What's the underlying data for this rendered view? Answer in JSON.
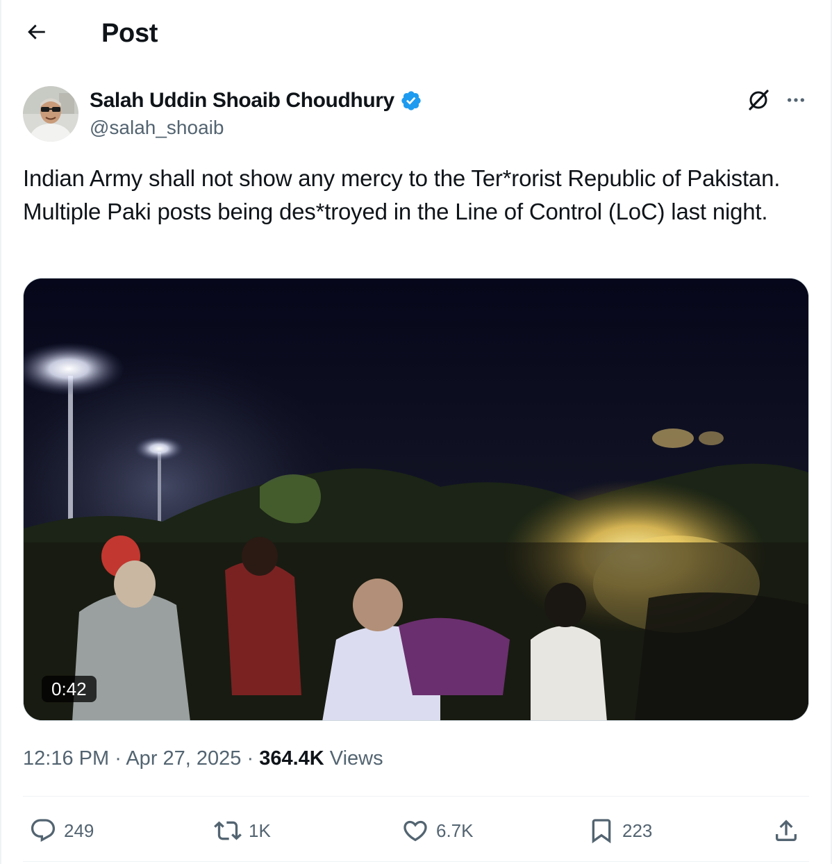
{
  "header": {
    "title": "Post",
    "back_icon": "arrow-left-icon"
  },
  "author": {
    "name": "Salah Uddin Shoaib Choudhury",
    "handle": "@salah_shoaib",
    "verified_color": "#1d9bf0"
  },
  "tweet": {
    "text": "Indian Army shall not show any mercy to the Ter*rorist Republic of Pakistan. Multiple Paki posts being des*troyed in the Line of Control (LoC) last night."
  },
  "media": {
    "type": "video",
    "duration": "0:42"
  },
  "meta": {
    "time": "12:16 PM",
    "separator": "·",
    "date": "Apr 27, 2025",
    "views_count": "364.4K",
    "views_label": "Views"
  },
  "actions": {
    "replies": "249",
    "reposts": "1K",
    "likes": "6.7K",
    "bookmarks": "223"
  },
  "colors": {
    "text_primary": "#0f1419",
    "text_secondary": "#536471",
    "accent": "#1d9bf0",
    "border": "#cfd9de"
  }
}
